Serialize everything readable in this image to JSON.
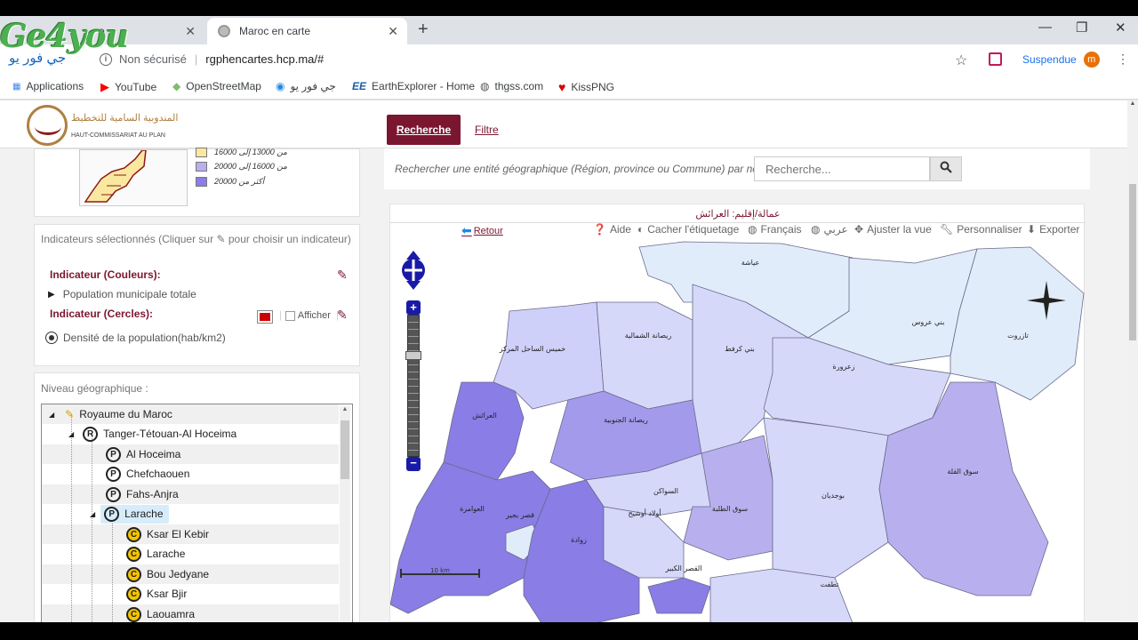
{
  "browser": {
    "inactive_tab_suffix": "e",
    "active_tab": "Maroc en carte",
    "security": "Non sécurisé",
    "url": "rgphencartes.hcp.ma/#",
    "profile_label": "Suspendue",
    "profile_initial": "m",
    "bookmarks": [
      "Applications",
      "YouTube",
      "OpenStreetMap",
      "جي فور يو",
      "EarthExplorer - Home",
      "thgss.com",
      "KissPNG"
    ]
  },
  "watermark": {
    "text": "Ge4you",
    "arabic": "جي فور يو"
  },
  "site": {
    "logo_ar": "المندوبية السامية للتخطيط",
    "logo_fr": "HAUT-COMMISSARIAT AU PLAN",
    "nav_recherche": "Recherche",
    "nav_filtre": "Filtre"
  },
  "legend": {
    "rows": [
      {
        "label": "من 13000 إلى 16000",
        "color": "#b8b0ee"
      },
      {
        "label": "من 16000 إلى 20000",
        "color": "#a49aec"
      },
      {
        "label": "أكثر من 20000",
        "color": "#8a7de6"
      }
    ]
  },
  "indicators": {
    "title_pre": "Indicateurs sélectionnés (Cliquer sur",
    "title_post": "pour choisir un indicateur)",
    "colors_label": "Indicateur (Couleurs):",
    "colors_value": "Population municipale totale",
    "circles_label": "Indicateur (Cercles):",
    "show_label": "Afficher",
    "circles_value": "Densité de la population(hab/km2)"
  },
  "niveau": {
    "title": "Niveau géographique :",
    "tree": [
      {
        "label": "Royaume du Maroc",
        "badge": "",
        "level": 0
      },
      {
        "label": "Tanger-Tétouan-Al Hoceima",
        "badge": "R",
        "level": 1
      },
      {
        "label": "Al Hoceima",
        "badge": "P",
        "level": 2
      },
      {
        "label": "Chefchaouen",
        "badge": "P",
        "level": 2
      },
      {
        "label": "Fahs-Anjra",
        "badge": "P",
        "level": 2
      },
      {
        "label": "Larache",
        "badge": "P",
        "level": 2,
        "selected": true
      },
      {
        "label": "Ksar El Kebir",
        "badge": "C",
        "level": 3
      },
      {
        "label": "Larache",
        "badge": "C",
        "level": 3
      },
      {
        "label": "Bou Jedyane",
        "badge": "C",
        "level": 3
      },
      {
        "label": "Ksar Bjir",
        "badge": "C",
        "level": 3
      },
      {
        "label": "Laouamra",
        "badge": "C",
        "level": 3
      }
    ]
  },
  "search": {
    "label": "Rechercher une entité géographique (Région, province ou Commune) par nom :",
    "placeholder": "Recherche..."
  },
  "map": {
    "title": "عمالة/إقليم: العرائش",
    "retour": "Retour",
    "tools": [
      "Aide",
      "Cacher l'étiquetage",
      "Français",
      "عربي",
      "Ajuster la vue",
      "Personnaliser",
      "Exporter"
    ],
    "scale": "10 km",
    "labels": {
      "ayacha": "عياشة",
      "beni_arous": "بني عروس",
      "tazroute": "تازروت",
      "khemis_sahel": "خميس الساحل المركز",
      "rissana_nord": "ريصانة الشمالية",
      "beni_garfet": "بني كرفط",
      "zaaroura": "زعرورة",
      "larache": "العرائش",
      "rissana_sud": "ريصانة الجنوبية",
      "souaken": "السواكن",
      "souk_tolba": "سوق الطلبة",
      "boujediane": "بوجديان",
      "souk_qolla": "سوق القلة",
      "laouamra": "العوامرة",
      "ksar_bjir": "قصر بجير",
      "zouada": "زوادة",
      "oulad_ouchih": "أولاد أوشيح",
      "ksar_kebir": "القصر الكبير",
      "tatoft": "تطفت"
    }
  }
}
